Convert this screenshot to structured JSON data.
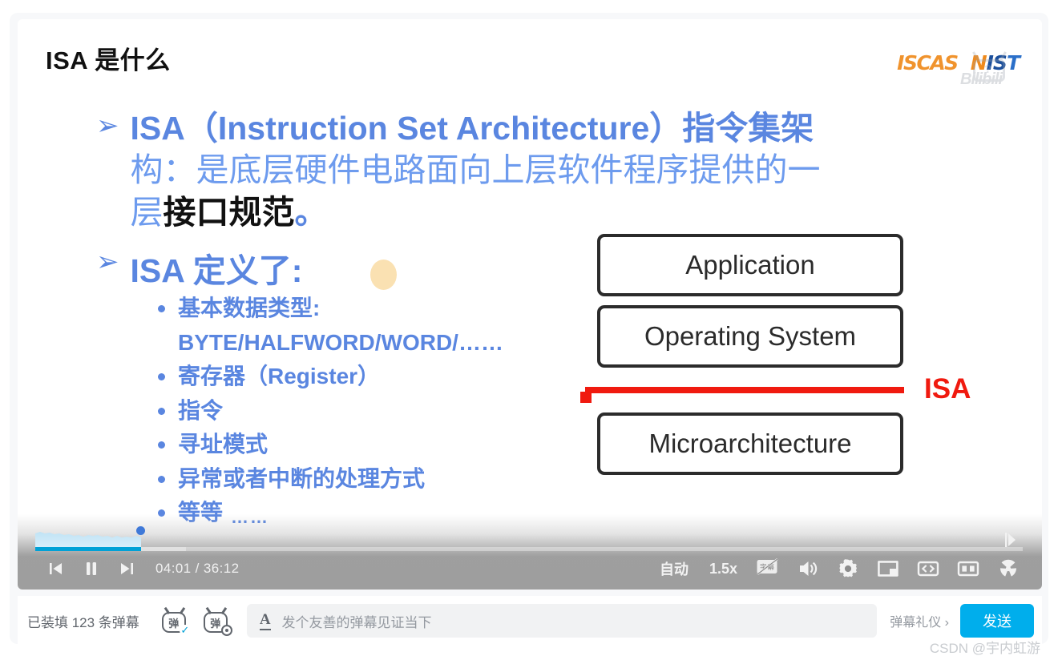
{
  "slide": {
    "title": "ISA 是什么",
    "logos": {
      "iscas": "ISCAS",
      "nist_part1": "N",
      "nist_part2": "IS",
      "nist_part3": "T"
    },
    "watermark_bili": "Bilibili",
    "bullets": [
      {
        "marker": "➢",
        "segments": [
          {
            "text": "ISA（Instruction Set Architecture）指令集架",
            "style": "bold-blue"
          },
          {
            "text": "构：是底层硬件电路面向上层软件程序提供的一",
            "style": "soft-blue"
          },
          {
            "text": "层",
            "style": "soft-blue"
          },
          {
            "text": "接口规范",
            "style": "black-bold"
          },
          {
            "text": "。",
            "style": "bold-blue"
          }
        ]
      },
      {
        "marker": "➢",
        "text": "ISA 定义了:"
      }
    ],
    "sub_bullets": [
      {
        "line1": "基本数据类型:",
        "line2": "BYTE/HALFWORD/WORD/……"
      },
      {
        "line1": "寄存器（Register）"
      },
      {
        "line1": "指令"
      },
      {
        "line1": "寻址模式"
      },
      {
        "line1": "异常或者中断的处理方式"
      },
      {
        "line1": "等等",
        "ellipsis": "……"
      }
    ],
    "diagram": {
      "boxes": [
        "Application",
        "Operating System",
        "Microarchitecture"
      ],
      "isa_label": "ISA",
      "isa_color": "#f01a0f"
    }
  },
  "player": {
    "progress": {
      "current_percent": 10.7,
      "buffered_percent": 15.3
    },
    "time_current": "04:01",
    "time_separator": "/",
    "time_total": "36:12",
    "left_controls": [
      {
        "name": "prev-episode-button",
        "icon": "previous-icon"
      },
      {
        "name": "pause-button",
        "icon": "pause-icon"
      },
      {
        "name": "next-episode-button",
        "icon": "next-icon"
      }
    ],
    "right_controls": [
      {
        "name": "quality-selector",
        "label": "自动",
        "type": "text"
      },
      {
        "name": "playback-speed-selector",
        "label": "1.5x",
        "type": "text"
      },
      {
        "name": "subtitle-toggle",
        "label": "字幕",
        "icon": "subtitle-off-icon",
        "type": "icon"
      },
      {
        "name": "volume-button",
        "icon": "volume-icon",
        "type": "icon"
      },
      {
        "name": "settings-button",
        "icon": "gear-icon",
        "type": "icon"
      },
      {
        "name": "picture-in-picture-button",
        "icon": "pip-icon",
        "type": "icon"
      },
      {
        "name": "widescreen-button",
        "icon": "widescreen-icon",
        "type": "icon"
      },
      {
        "name": "fullscreen-button",
        "icon": "fullscreen-icon",
        "type": "icon"
      },
      {
        "name": "danmaku-nuclear-button",
        "icon": "radiation-icon",
        "type": "icon"
      }
    ]
  },
  "danmaku_bar": {
    "count_text": "已装填 123 条弹幕",
    "danmaku_toggle_glyph": "弹",
    "danmaku_settings_glyph": "弹",
    "style_icon": "A",
    "input_placeholder": "发个友善的弹幕见证当下",
    "etiquette_label": "弹幕礼仪 ›",
    "send_label": "发送",
    "send_color": "#00aeec"
  },
  "watermark": {
    "csdn": "CSDN @宇内虹游"
  }
}
